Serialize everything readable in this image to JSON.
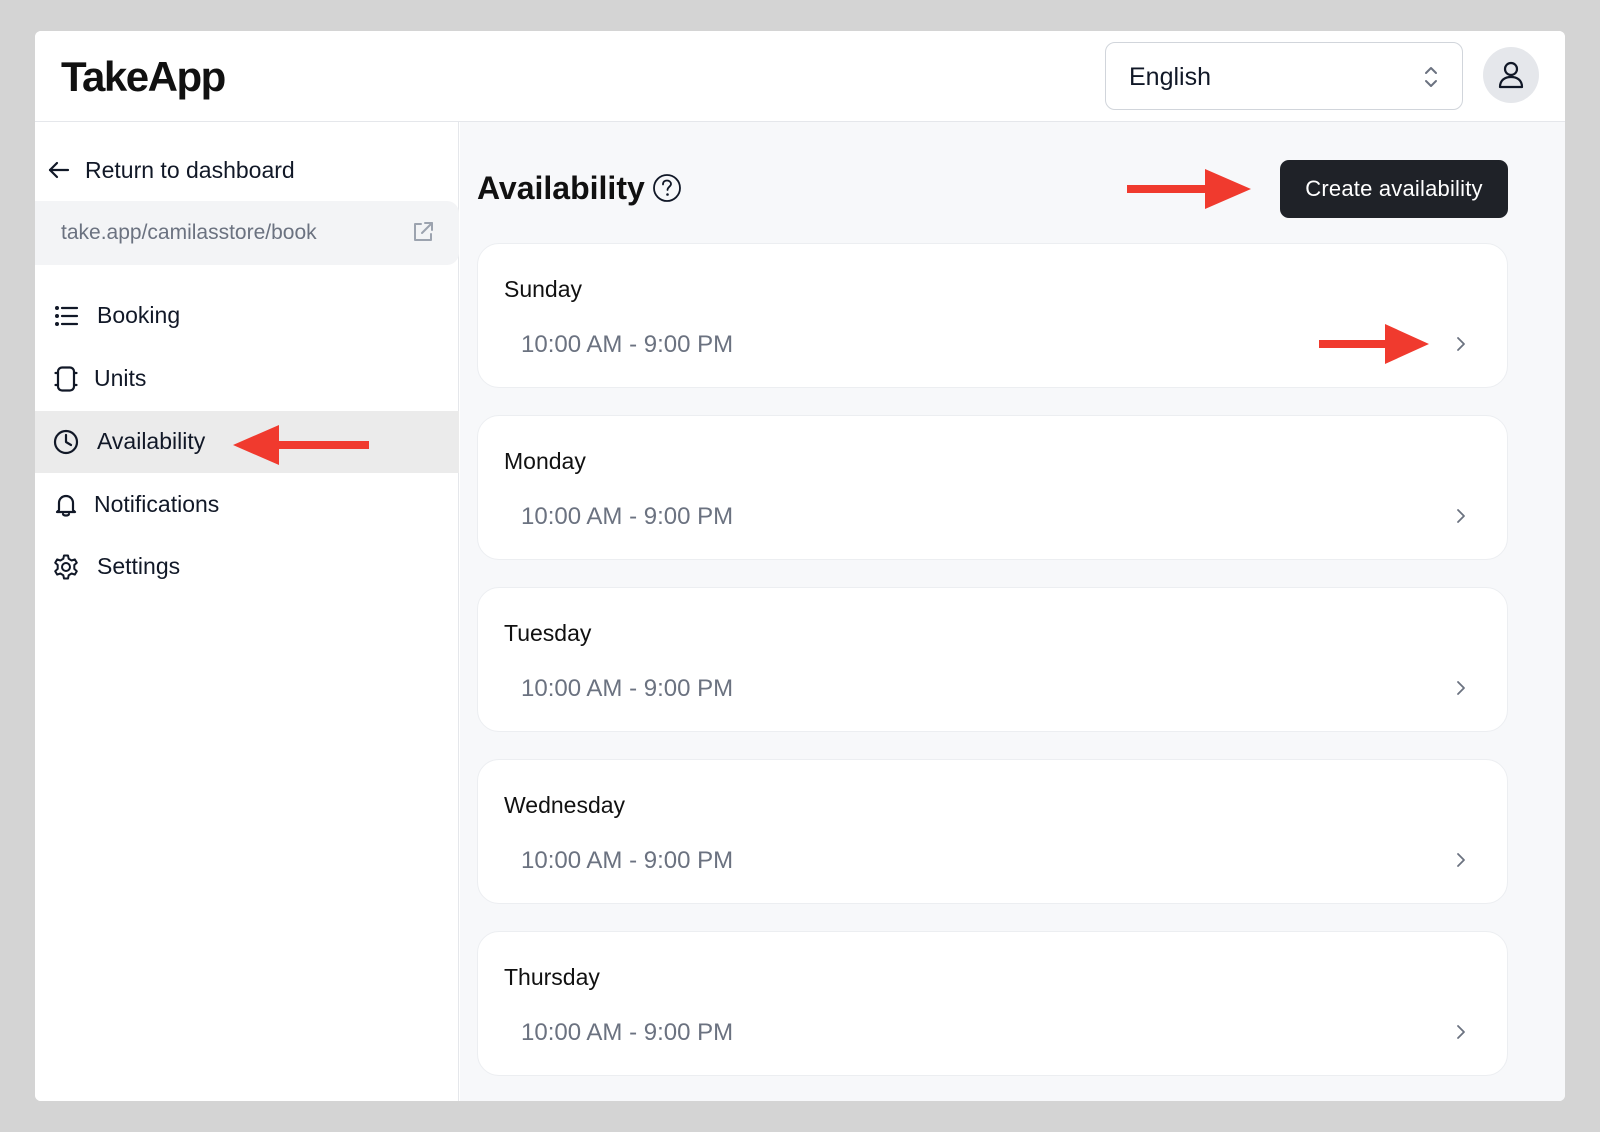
{
  "app": {
    "logo": "TakeApp"
  },
  "header": {
    "language_select": {
      "value": "English"
    }
  },
  "sidebar": {
    "return_label": "Return to dashboard",
    "store_url": "take.app/camilasstore/book",
    "nav_items": [
      {
        "label": "Booking",
        "icon": "list-icon",
        "active": false
      },
      {
        "label": "Units",
        "icon": "device-icon",
        "active": false
      },
      {
        "label": "Availability",
        "icon": "clock-icon",
        "active": true
      },
      {
        "label": "Notifications",
        "icon": "bell-icon",
        "active": false
      },
      {
        "label": "Settings",
        "icon": "gear-icon",
        "active": false
      }
    ]
  },
  "main": {
    "title": "Availability",
    "create_button": "Create availability",
    "days": [
      {
        "name": "Sunday",
        "hours": "10:00 AM - 9:00 PM"
      },
      {
        "name": "Monday",
        "hours": "10:00 AM - 9:00 PM"
      },
      {
        "name": "Tuesday",
        "hours": "10:00 AM - 9:00 PM"
      },
      {
        "name": "Wednesday",
        "hours": "10:00 AM - 9:00 PM"
      },
      {
        "name": "Thursday",
        "hours": "10:00 AM - 9:00 PM"
      }
    ]
  },
  "colors": {
    "annotation_arrow": "#f03a2e",
    "primary_button": "#1f2228",
    "active_nav_bg": "#ebebeb",
    "page_bg": "#f7f8fa"
  }
}
